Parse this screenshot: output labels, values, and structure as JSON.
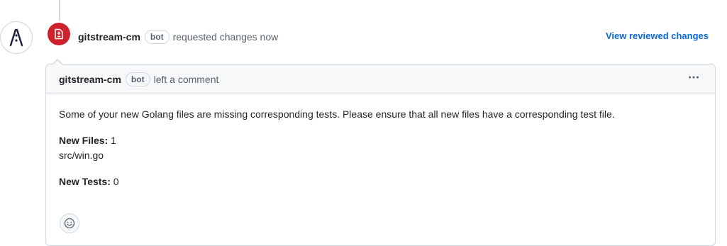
{
  "event": {
    "author": "gitstream-cm",
    "bot_badge": "bot",
    "action_text": "requested changes now",
    "view_link": "View reviewed changes",
    "badge_icon": "file-diff-icon",
    "badge_color": "#cf222e"
  },
  "comment": {
    "author": "gitstream-cm",
    "bot_badge": "bot",
    "action_text": "left a comment",
    "menu_icon": "kebab-horizontal-icon",
    "body": {
      "intro": "Some of your new Golang files are missing corresponding tests. Please ensure that all new files have a corresponding test file.",
      "new_files_label": "New Files:",
      "new_files_value": " 1",
      "file_path": "src/win.go",
      "new_tests_label": "New Tests:",
      "new_tests_value": " 0"
    },
    "reaction_icon": "smiley-icon"
  },
  "colors": {
    "link": "#0969da",
    "muted": "#59636e",
    "border": "#d0d7de",
    "header_bg": "#f6f8fa"
  }
}
